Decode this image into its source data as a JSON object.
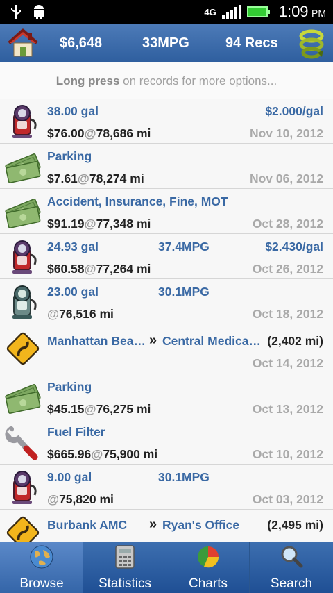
{
  "status_bar": {
    "network": "4G",
    "time": "1:09",
    "ampm": "PM"
  },
  "header": {
    "total_cost": "$6,648",
    "avg_mpg": "33MPG",
    "record_count": "94 Recs"
  },
  "hint": {
    "bold": "Long press",
    "rest": " on records for more options..."
  },
  "records": [
    {
      "type": "fuel",
      "icon": "gas-pump-red-icon",
      "a": "38.00 gal",
      "b": "",
      "c": "$2.000/gal",
      "amount": "$76.00",
      "at": "@",
      "odometer": "78,686 mi",
      "date": "Nov 10, 2012"
    },
    {
      "type": "expense",
      "icon": "money-icon",
      "a": "Parking",
      "b": "",
      "c": "",
      "amount": "$7.61",
      "at": "@",
      "odometer": "78,274 mi",
      "date": "Nov 06, 2012"
    },
    {
      "type": "expense",
      "icon": "money-icon",
      "a": "Accident, Insurance, Fine, MOT",
      "b": "",
      "c": "",
      "amount": "$91.19",
      "at": "@",
      "odometer": "77,348 mi",
      "date": "Oct 28, 2012"
    },
    {
      "type": "fuel",
      "icon": "gas-pump-red-icon",
      "a": "24.93 gal",
      "b": "37.4MPG",
      "c": "$2.430/gal",
      "amount": "$60.58",
      "at": "@",
      "odometer": "77,264 mi",
      "date": "Oct 26, 2012"
    },
    {
      "type": "fuel",
      "icon": "gas-pump-green-icon",
      "a": "23.00 gal",
      "b": "30.1MPG",
      "c": "",
      "amount": "",
      "at": "@",
      "odometer": "76,516 mi",
      "date": "Oct 18, 2012"
    },
    {
      "type": "trip",
      "icon": "road-sign-icon",
      "from": "Manhattan Bea…",
      "arrow": "»",
      "to": "Central Medica…",
      "dist": "(2,402 mi)",
      "date": "Oct 14, 2012"
    },
    {
      "type": "expense",
      "icon": "money-icon",
      "a": "Parking",
      "b": "",
      "c": "",
      "amount": "$45.15",
      "at": "@",
      "odometer": "76,275 mi",
      "date": "Oct 13, 2012"
    },
    {
      "type": "service",
      "icon": "wrench-icon",
      "a": "Fuel Filter",
      "b": "",
      "c": "",
      "amount": "$665.96",
      "at": "@",
      "odometer": "75,900 mi",
      "date": "Oct 10, 2012"
    },
    {
      "type": "fuel",
      "icon": "gas-pump-red-icon",
      "a": "9.00 gal",
      "b": "30.1MPG",
      "c": "",
      "amount": "",
      "at": "@",
      "odometer": "75,820 mi",
      "date": "Oct 03, 2012"
    },
    {
      "type": "trip",
      "icon": "road-sign-icon",
      "from": "Burbank AMC",
      "arrow": "»",
      "to": "Ryan's Office",
      "dist": "(2,495 mi)",
      "date": ""
    }
  ],
  "nav": [
    {
      "label": "Browse",
      "icon": "globe-icon",
      "active": true
    },
    {
      "label": "Statistics",
      "icon": "calculator-icon",
      "active": false
    },
    {
      "label": "Charts",
      "icon": "pie-chart-icon",
      "active": false
    },
    {
      "label": "Search",
      "icon": "magnifier-icon",
      "active": false
    }
  ],
  "colors": {
    "header": "#3a69a4",
    "link_text": "#3a69a4",
    "muted_date": "#a9a9a9"
  }
}
